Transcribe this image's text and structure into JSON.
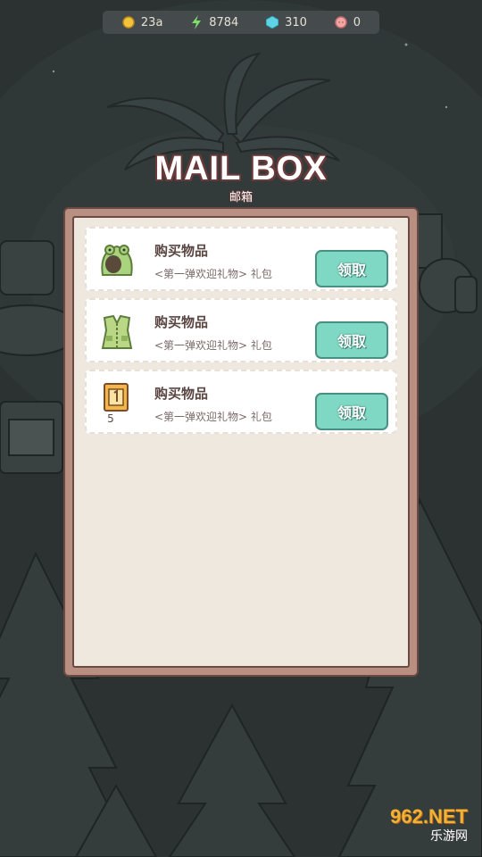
{
  "resources": {
    "coins": "23a",
    "energy": "8784",
    "gems": "310",
    "hearts": "0"
  },
  "header": {
    "title": "MAIL BOX",
    "subtitle": "邮箱"
  },
  "mails": [
    {
      "title": "购买物品",
      "description": "<第一弹欢迎礼物> 礼包",
      "button": "领取",
      "icon": "green-frog-hood-icon"
    },
    {
      "title": "购买物品",
      "description": "<第一弹欢迎礼物> 礼包",
      "button": "领取",
      "icon": "green-vest-icon"
    },
    {
      "title": "购买物品",
      "description": "<第一弹欢迎礼物> 礼包",
      "button": "领取",
      "icon": "ticket-icon",
      "count": "5"
    }
  ],
  "watermark": {
    "main": "962.NET",
    "sub": "乐游网"
  },
  "colors": {
    "claim_button": "#7fd8c4",
    "panel_border": "#6a4a42",
    "panel_bg": "#efe8df"
  }
}
